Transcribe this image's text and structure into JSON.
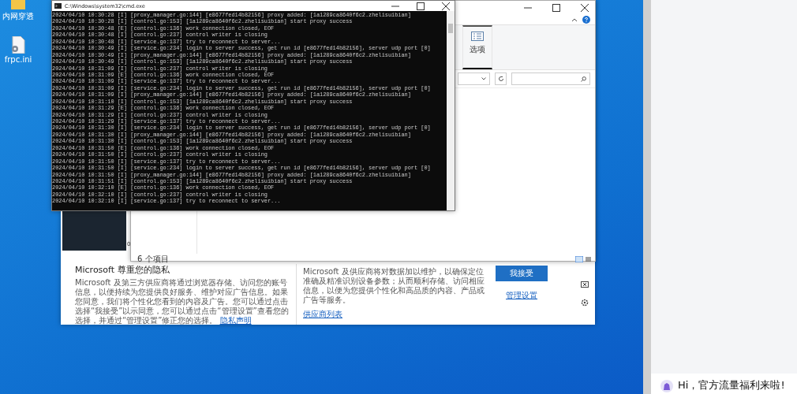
{
  "desktop_icons": [
    {
      "kind": "folder",
      "label": "内网穿透"
    },
    {
      "kind": "file",
      "label": "frpc.ini"
    }
  ],
  "browser_window": {
    "photo_count": "0",
    "consent": {
      "title": "Microsoft 尊重您的隐私",
      "body": "Microsoft 及第三方供应商将通过浏览器存储、访问您的账号信息，以便持续为您提供良好服务、维护对应广告信息。如果您同意，我们将个性化您看到的内容及广告。您可以通过点击选择“我接受”以示同意，您可以通过点击“管理设置”查看您的选择，并通过“管理设置”修正您的选择。",
      "privacy_link": "隐私声明",
      "vendor_body": "Microsoft 及供应商将对数据加以维护，以确保定位准确及精准识别设备参数；从而顺利存储、访问相应信息，以便为您提供个性化和高品质的内容、产品或广告等服务。",
      "vendor_link": "供应商列表",
      "accept_button": "我接受",
      "manage_link": "管理设置"
    }
  },
  "explorer_window": {
    "ribbon_button": "选项",
    "status": "6 个项目"
  },
  "cmd_window": {
    "title": "C:\\Windows\\system32\\cmd.exe",
    "lines": [
      "2024/04/10 10:30:28 [I] [proxy_manager.go:144] [e8677fed14b82156] proxy added: [1a1289ca8640f6c2.zhelisuibian]",
      "2024/04/10 10:30:28 [I] [control.go:153] [1a1289ca8640f6c2.zhelisuibian] start proxy success",
      "2024/04/10 10:30:48 [E] [control.go:136] work connection closed, EOF",
      "2024/04/10 10:30:48 [I] [control.go:237] control writer is closing",
      "2024/04/10 10:30:48 [I] [service.go:137] try to reconnect to server...",
      "2024/04/10 10:30:49 [I] [service.go:234] login to server success, get run id [e8677fed14b82156], server udp port [0]",
      "2024/04/10 10:30:49 [I] [proxy_manager.go:144] [e8677fed14b82156] proxy added: [1a1289ca8640f6c2.zhelisuibian]",
      "2024/04/10 10:30:49 [I] [control.go:153] [1a1289ca8640f6c2.zhelisuibian] start proxy success",
      "2024/04/10 10:31:09 [I] [control.go:237] control writer is closing",
      "2024/04/10 10:31:09 [E] [control.go:136] work connection closed, EOF",
      "2024/04/10 10:31:09 [I] [service.go:137] try to reconnect to server...",
      "2024/04/10 10:31:09 [I] [service.go:234] login to server success, get run id [e8677fed14b82156], server udp port [0]",
      "2024/04/10 10:31:09 [I] [proxy_manager.go:144] [e8677fed14b82156] proxy added: [1a1289ca8640f6c2.zhelisuibian]",
      "2024/04/10 10:31:10 [I] [control.go:153] [1a1289ca8640f6c2.zhelisuibian] start proxy success",
      "2024/04/10 10:31:29 [E] [control.go:136] work connection closed, EOF",
      "2024/04/10 10:31:29 [I] [control.go:237] control writer is closing",
      "2024/04/10 10:31:29 [I] [service.go:137] try to reconnect to server...",
      "2024/04/10 10:31:30 [I] [service.go:234] login to server success, get run id [e8677fed14b82156], server udp port [0]",
      "2024/04/10 10:31:30 [I] [proxy_manager.go:144] [e8677fed14b82156] proxy added: [1a1289ca8640f6c2.zhelisuibian]",
      "2024/04/10 10:31:30 [I] [control.go:153] [1a1289ca8640f6c2.zhelisuibian] start proxy success",
      "2024/04/10 10:31:50 [E] [control.go:136] work connection closed, EOF",
      "2024/04/10 10:31:50 [I] [control.go:237] control writer is closing",
      "2024/04/10 10:31:50 [I] [service.go:137] try to reconnect to server...",
      "2024/04/10 10:31:50 [I] [service.go:234] login to server success, get run id [e8677fed14b82156], server udp port [0]",
      "2024/04/10 10:31:50 [I] [proxy_manager.go:144] [e8677fed14b82156] proxy added: [1a1289ca8640f6c2.zhelisuibian]",
      "2024/04/10 10:31:51 [I] [control.go:153] [1a1289ca8640f6c2.zhelisuibian] start proxy success",
      "2024/04/10 10:32:10 [E] [control.go:136] work connection closed, EOF",
      "2024/04/10 10:32:10 [I] [control.go:237] control writer is closing",
      "2024/04/10 10:32:10 [I] [service.go:137] try to reconnect to server..."
    ]
  },
  "side_panel": {
    "greeting": "Hi，官方流量福利来啦!"
  }
}
